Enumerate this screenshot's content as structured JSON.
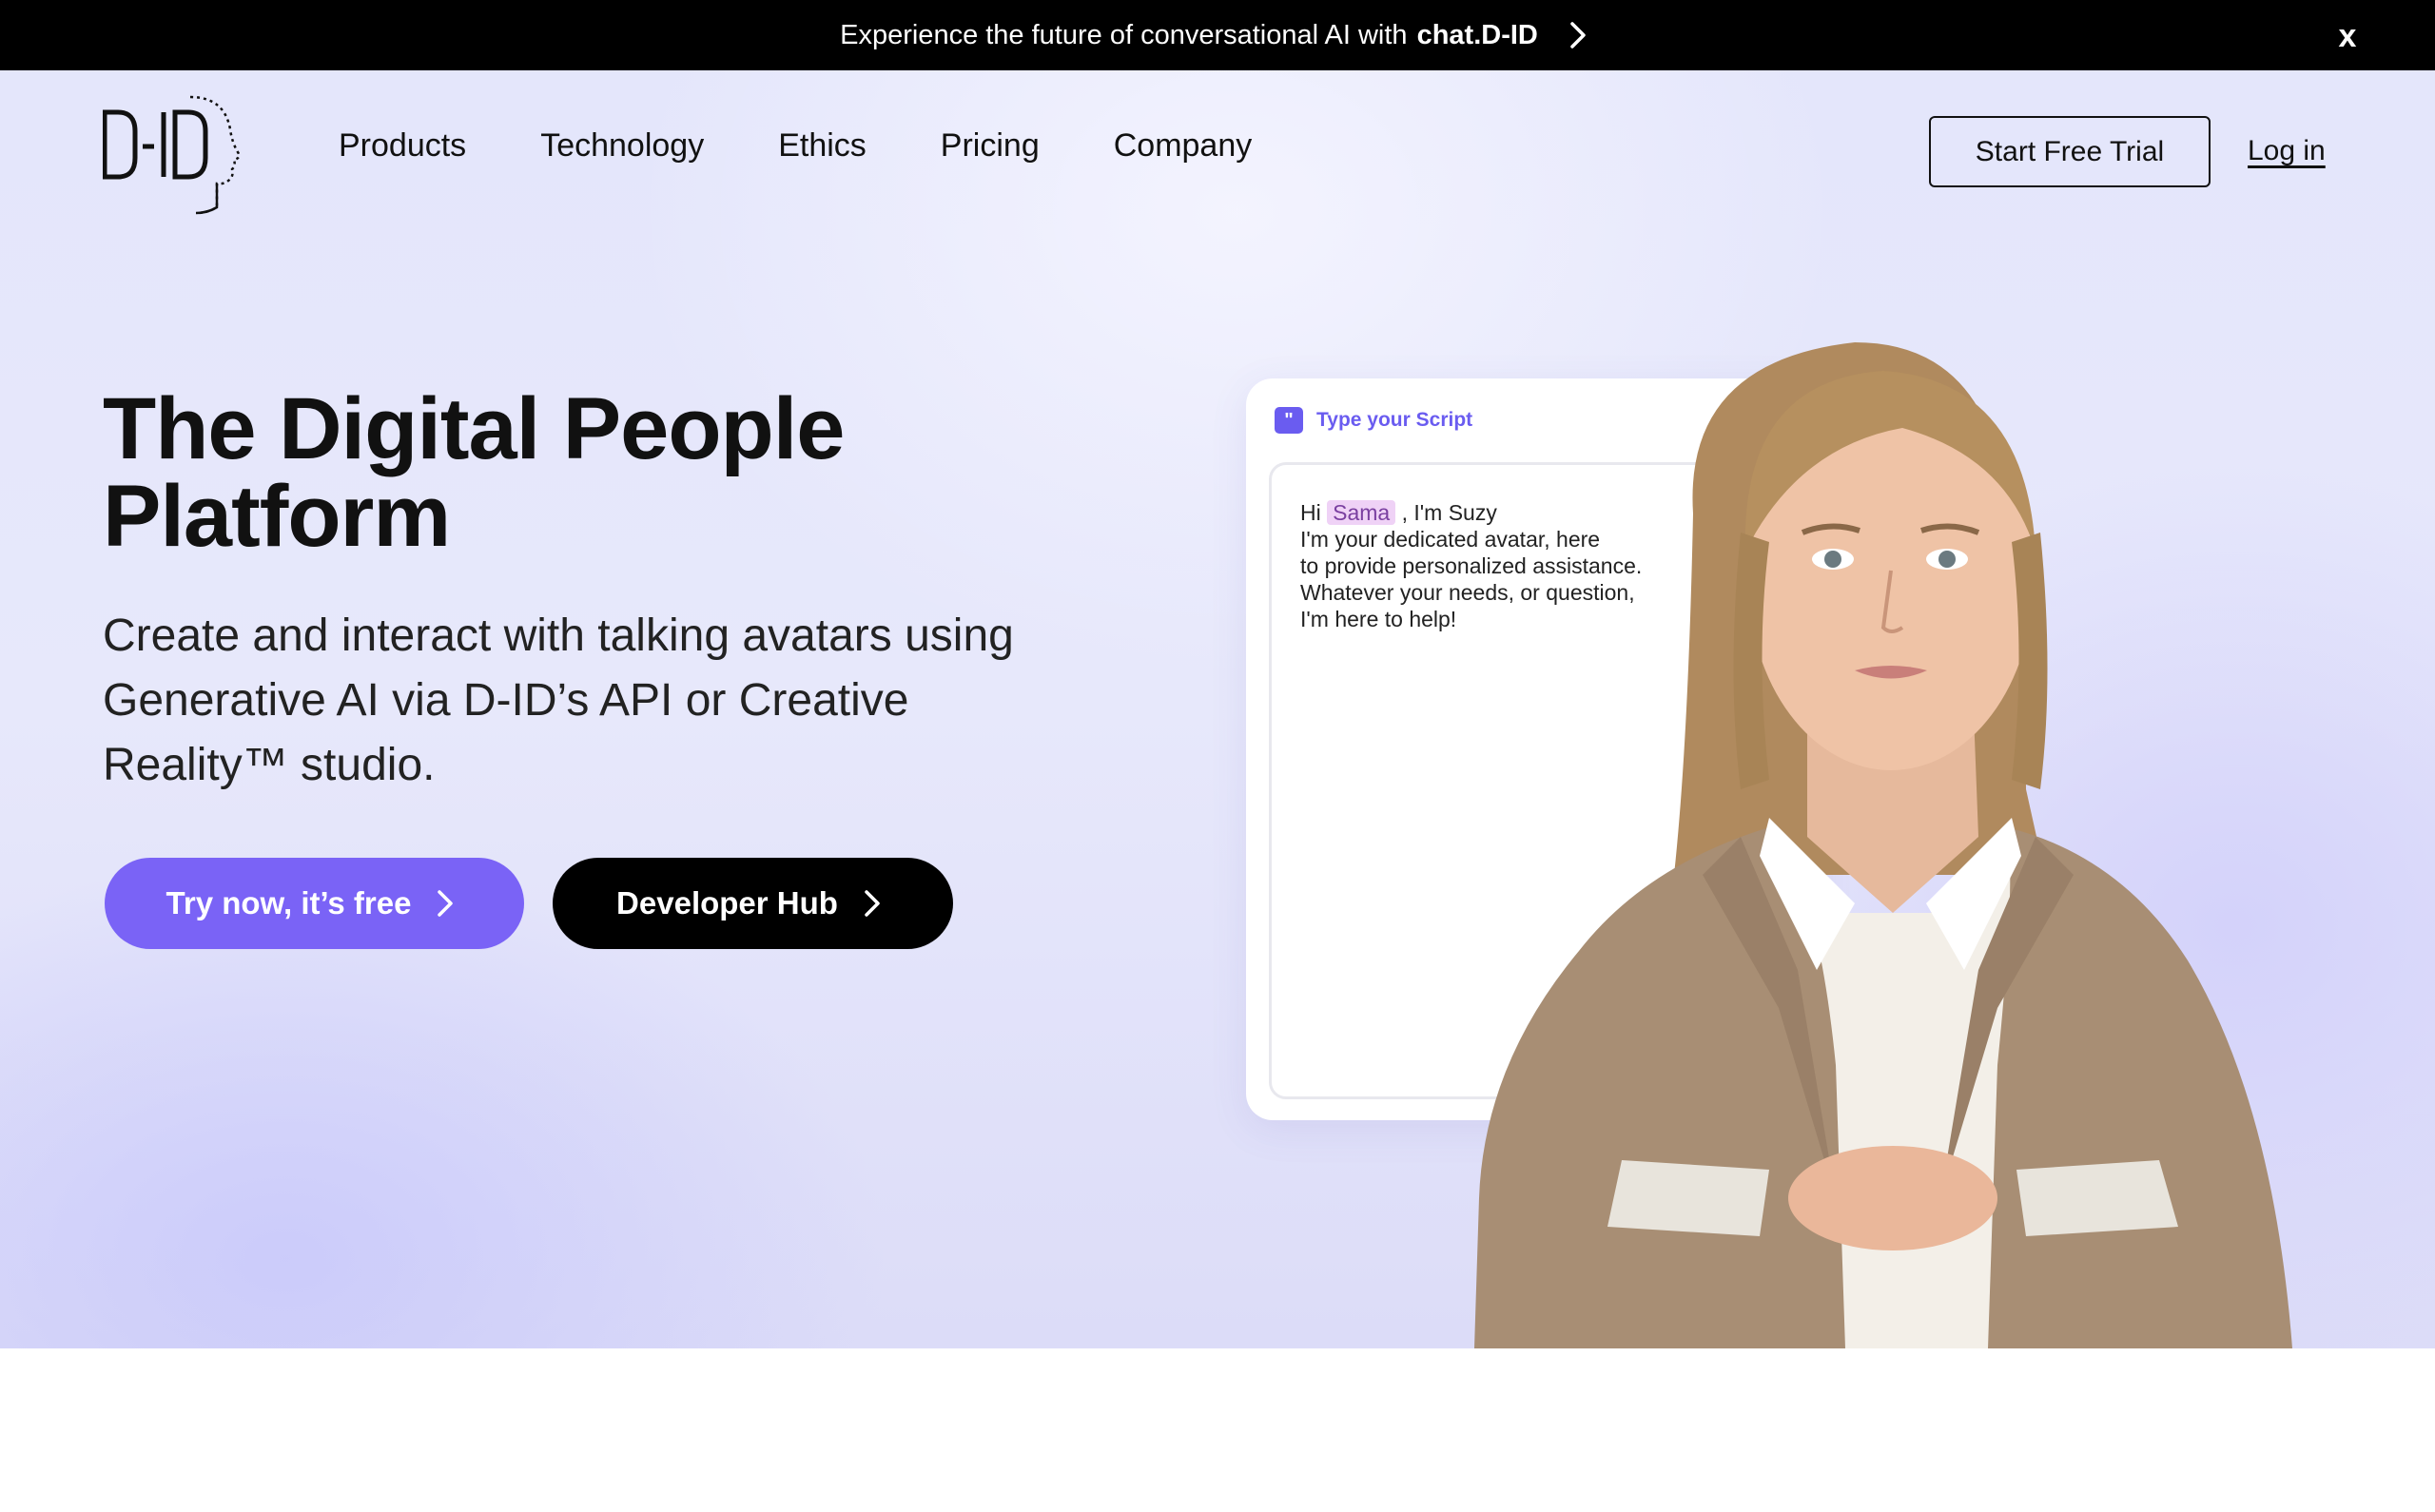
{
  "announcement": {
    "text": "Experience the future of conversational AI with",
    "brand": "chat.D-ID",
    "close_label": "x"
  },
  "nav": {
    "logo_text": "D-ID",
    "items": [
      {
        "label": "Products"
      },
      {
        "label": "Technology"
      },
      {
        "label": "Ethics"
      },
      {
        "label": "Pricing"
      },
      {
        "label": "Company"
      }
    ],
    "trial_label": "Start Free Trial",
    "login_label": "Log in"
  },
  "hero": {
    "title_line1": "The Digital People",
    "title_line2": "Platform",
    "subtitle": "Create and interact with talking avatars using Generative AI via D-ID’s API or Creative Reality™ studio.",
    "primary_cta": "Try now, it’s free",
    "secondary_cta": "Developer Hub"
  },
  "script_card": {
    "header": "Type your Script",
    "greeting": "Hi",
    "name": "Sama",
    "line1_rest": ", I'm Suzy",
    "line2": "I'm your dedicated avatar, here",
    "line3": "to provide personalized assistance.",
    "line4": "Whatever your needs, or question,",
    "line5": "I'm here to help!"
  },
  "colors": {
    "accent": "#7a63f6",
    "dark": "#000000",
    "hero_bg": "#e4e6fb",
    "script_accent": "#6a5cf0",
    "highlight": "#efd2f6"
  }
}
